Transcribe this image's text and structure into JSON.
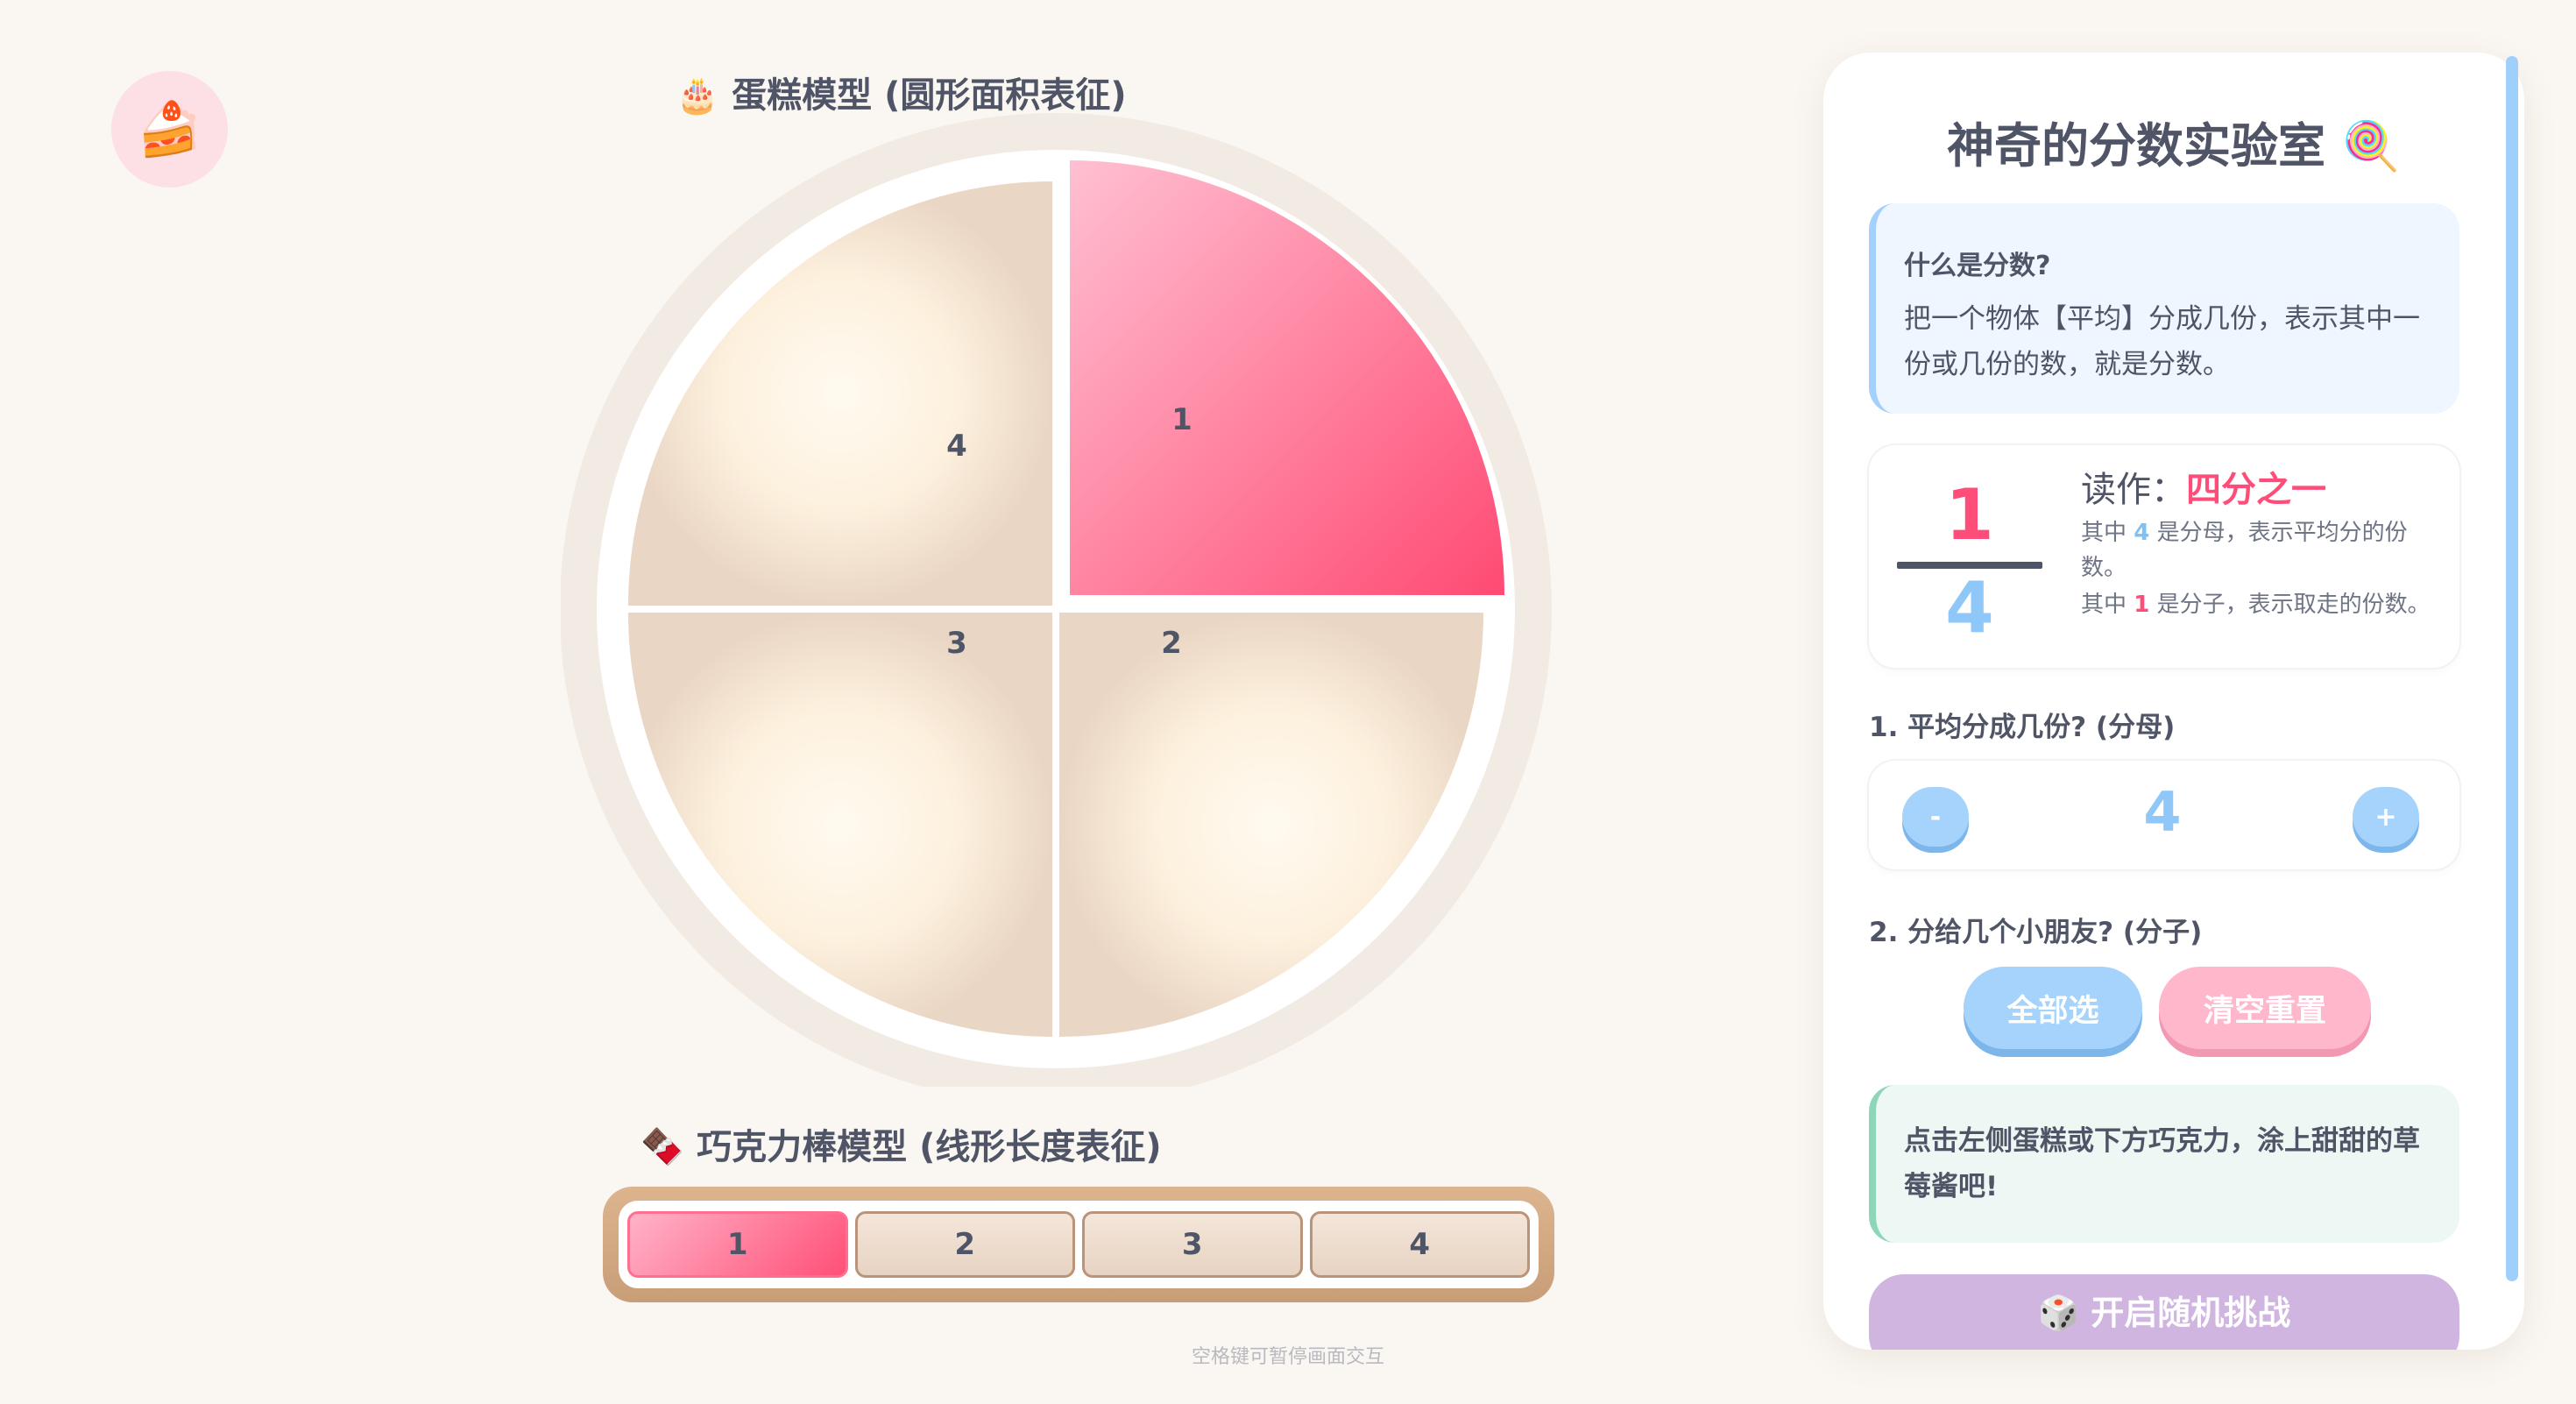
{
  "logo_icon": "cake-slice-emoji",
  "logo_glyph": "🍰",
  "cake": {
    "title_icon": "🎂",
    "title": "蛋糕模型 (圆形面积表征)",
    "pieces": [
      {
        "label": "1",
        "selected": true
      },
      {
        "label": "2",
        "selected": false
      },
      {
        "label": "3",
        "selected": false
      },
      {
        "label": "4",
        "selected": false
      }
    ]
  },
  "bar": {
    "title_icon": "🍫",
    "title": "巧克力棒模型 (线形长度表征)",
    "pieces": [
      {
        "label": "1",
        "selected": true
      },
      {
        "label": "2",
        "selected": false
      },
      {
        "label": "3",
        "selected": false
      },
      {
        "label": "4",
        "selected": false
      }
    ]
  },
  "hint": "空格键可暂停画面交互",
  "panel": {
    "title": "神奇的分数实验室 🍭",
    "info": {
      "question": "什么是分数?",
      "answer": "把一个物体【平均】分成几份，表示其中一份或几份的数，就是分数。"
    },
    "fraction": {
      "numerator": "1",
      "denominator": "4",
      "read_label": "读作：",
      "read_value": "四分之一",
      "expl1_pre": "其中 ",
      "expl1_num": "4",
      "expl1_post": " 是分母，表示平均分的份数。",
      "expl2_pre": "其中 ",
      "expl2_num": "1",
      "expl2_post": " 是分子，表示取走的份数。"
    },
    "q1": "1. 平均分成几份? (分母)",
    "stepper": {
      "minus": "-",
      "value": "4",
      "plus": "+"
    },
    "q2": "2. 分给几个小朋友? (分子)",
    "btn_all": "全部选",
    "btn_clear": "清空重置",
    "tip": "点击左侧蛋糕或下方巧克力，涂上甜甜的草莓酱吧!",
    "challenge": "🎲 开启随机挑战"
  },
  "colors": {
    "selected_start": "#ffb3c8",
    "selected_end": "#ff4f77",
    "accent_blue": "#a6d3fb",
    "accent_pink": "#ff4d79"
  }
}
